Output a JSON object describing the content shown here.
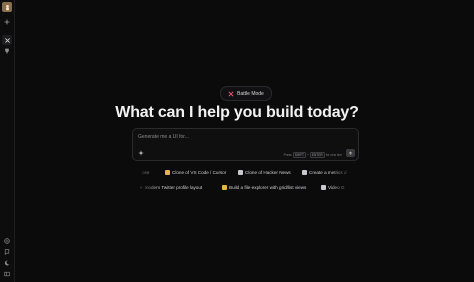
{
  "mode_badge": {
    "label": "Battle Mode",
    "icon": "crossed-swords-icon",
    "icon_color": "#e0566a"
  },
  "headline": "What can I help you build today?",
  "prompt": {
    "placeholder": "Generate me a UI for...",
    "hint_press": "Press",
    "hint_key1": "SHIFT",
    "hint_plus": "+",
    "hint_key2": "ENTER",
    "hint_tail": "for new line"
  },
  "suggestions_row1": [
    {
      "label": "Clone of VS Code / Cursor",
      "icon_color": "#e6b44a"
    },
    {
      "label": "Clone of Hacker News",
      "icon_color": "#c9c9cc"
    },
    {
      "label": "Create a metrics d",
      "icon_color": "#c9c9cc"
    }
  ],
  "suggestions_row1_partial": "ose",
  "suggestions_row2": [
    {
      "label": "modern Twitter profile layout",
      "icon_color": "#7a9ce0"
    },
    {
      "label": "Build a file-explorer with grid/list views",
      "icon_color": "#e6b44a"
    },
    {
      "label": "Video G",
      "icon_color": "#c9c9cc"
    }
  ],
  "suggestions_row2_partial": "e"
}
